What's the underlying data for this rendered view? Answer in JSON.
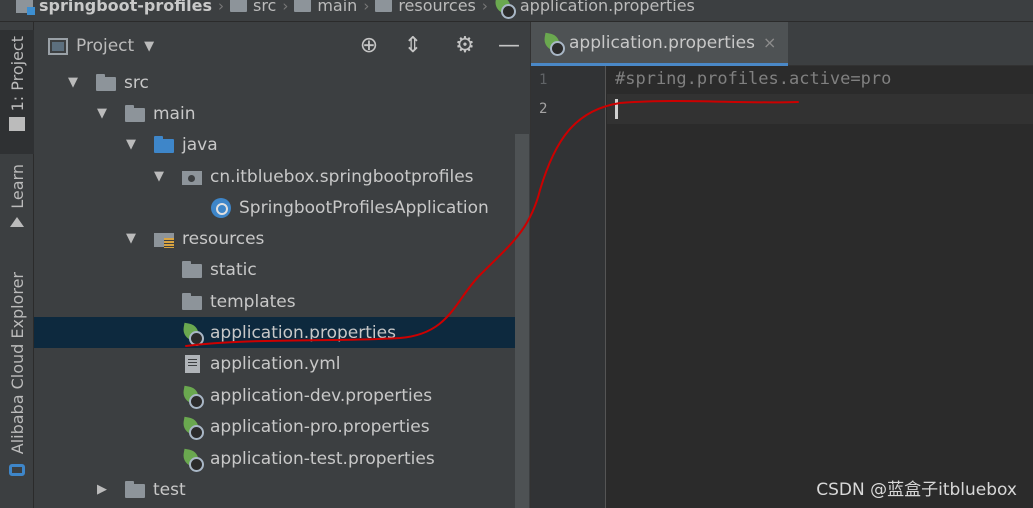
{
  "breadcrumb": [
    {
      "label": "springboot-profiles",
      "icon": "module-icon"
    },
    {
      "label": "src",
      "icon": "folder-icon"
    },
    {
      "label": "main",
      "icon": "folder-icon"
    },
    {
      "label": "resources",
      "icon": "resources-folder-icon"
    },
    {
      "label": "application.properties",
      "icon": "spring-properties-icon"
    }
  ],
  "toolstrip": {
    "project": "1: Project",
    "learn": "Learn",
    "alibaba": "Alibaba Cloud Explorer"
  },
  "panel": {
    "title": "Project",
    "dropdown_icon": "chevron-down-icon",
    "actions": [
      "locate-icon",
      "collapse-all-icon",
      "gear-icon",
      "hide-icon"
    ]
  },
  "tree": [
    {
      "label": "src",
      "level": 1,
      "expanded": true,
      "icon": "folder-icon"
    },
    {
      "label": "main",
      "level": 2,
      "expanded": true,
      "icon": "folder-icon"
    },
    {
      "label": "java",
      "level": 3,
      "expanded": true,
      "icon": "source-folder-icon"
    },
    {
      "label": "cn.itbluebox.springbootprofiles",
      "level": 4,
      "expanded": true,
      "icon": "package-icon"
    },
    {
      "label": "SpringbootProfilesApplication",
      "level": 5,
      "icon": "spring-app-icon"
    },
    {
      "label": "resources",
      "level": 3,
      "expanded": true,
      "icon": "resources-folder-icon"
    },
    {
      "label": "static",
      "level": 4,
      "icon": "folder-icon"
    },
    {
      "label": "templates",
      "level": 4,
      "icon": "folder-icon"
    },
    {
      "label": "application.properties",
      "level": 4,
      "icon": "spring-properties-icon",
      "selected": true
    },
    {
      "label": "application.yml",
      "level": 4,
      "icon": "yaml-file-icon"
    },
    {
      "label": "application-dev.properties",
      "level": 4,
      "icon": "spring-properties-icon"
    },
    {
      "label": "application-pro.properties",
      "level": 4,
      "icon": "spring-properties-icon"
    },
    {
      "label": "application-test.properties",
      "level": 4,
      "icon": "spring-properties-icon"
    },
    {
      "label": "test",
      "level": 2,
      "expanded": false,
      "icon": "folder-icon"
    }
  ],
  "editor": {
    "tab_label": "application.properties",
    "close_glyph": "×",
    "lines": [
      {
        "number": "1",
        "text": "#spring.profiles.active=pro"
      },
      {
        "number": "2",
        "text": ""
      }
    ]
  },
  "watermark": "CSDN @蓝盒子itbluebox",
  "colors": {
    "background": "#2b2b2b",
    "panel": "#3c3f41",
    "selection": "#0d293e",
    "comment": "#808080",
    "tab_underline": "#4a88c7",
    "annotation_stroke": "#cc0000"
  }
}
